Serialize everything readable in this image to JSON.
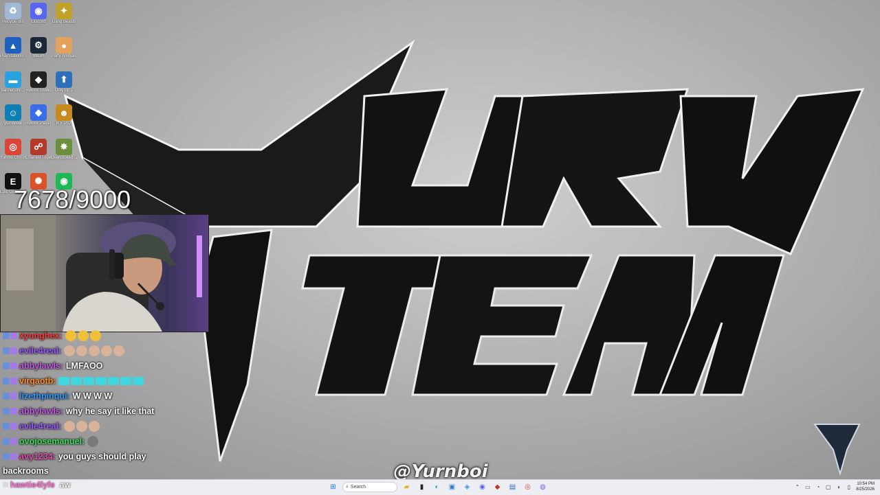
{
  "desktop": {
    "icons": [
      {
        "label": "Recycle Bin",
        "icon": "recycle-bin-icon",
        "color": "#9fb9d6",
        "glyph": "♻"
      },
      {
        "label": "Discord",
        "icon": "discord-icon",
        "color": "#5865f2",
        "glyph": "◉"
      },
      {
        "label": "Gang Beasts",
        "icon": "gang-beasts-icon",
        "color": "#c2a12a",
        "glyph": "✦"
      },
      {
        "label": "PlayStation® Accessories",
        "icon": "playstation-icon",
        "color": "#1f5fbf",
        "glyph": "▲"
      },
      {
        "label": "Steam",
        "icon": "steam-icon",
        "color": "#1b2838",
        "glyph": "⚙"
      },
      {
        "label": "Party Animals",
        "icon": "party-animals-icon",
        "color": "#e3a35a",
        "glyph": "●"
      },
      {
        "label": "bannerjohn...",
        "icon": "file-icon",
        "color": "#29a3e0",
        "glyph": "▬"
      },
      {
        "label": "Roblox Studio",
        "icon": "roblox-studio-icon",
        "color": "#222222",
        "glyph": "◆"
      },
      {
        "label": "Only Up 2",
        "icon": "only-up-icon",
        "color": "#2d6fb8",
        "glyph": "⬆"
      },
      {
        "label": "yurnbowe",
        "icon": "game-icon",
        "color": "#0d7fb5",
        "glyph": "☺"
      },
      {
        "label": "Roblox Player",
        "icon": "roblox-player-icon",
        "color": "#3a6ee8",
        "glyph": "◆"
      },
      {
        "label": "R.E.P.O.",
        "icon": "repo-icon",
        "color": "#c68a1d",
        "glyph": "☻"
      },
      {
        "label": "Yurnbo Chrome",
        "icon": "chrome-icon",
        "color": "#db4437",
        "glyph": "◎"
      },
      {
        "label": "Chained Together",
        "icon": "chained-together-icon",
        "color": "#b33a2a",
        "glyph": "☍"
      },
      {
        "label": "Overcooked! 2",
        "icon": "overcooked-icon",
        "color": "#6b8f3a",
        "glyph": "✸"
      },
      {
        "label": "Epic Games Launcher",
        "icon": "epic-games-icon",
        "color": "#111111",
        "glyph": "E"
      },
      {
        "label": "",
        "icon": "game-icon",
        "color": "#d9522a",
        "glyph": "✺"
      },
      {
        "label": "",
        "icon": "spotify-icon",
        "color": "#1db954",
        "glyph": "◉"
      }
    ]
  },
  "overlay": {
    "goal_counter": "7678/9000",
    "watermark": "@Yurnboi"
  },
  "chat": {
    "messages": [
      {
        "user": "xyunghex",
        "user_color": "#ff3b3b",
        "message": "",
        "emotes": [
          "#f2c037",
          "#f2c037",
          "#f2c037"
        ],
        "emote_style": "round"
      },
      {
        "user": "evile4real",
        "user_color": "#9b59ff",
        "message": "",
        "emotes": [
          "#d9b29a",
          "#d9b29a",
          "#d9b29a",
          "#d9b29a",
          "#d9b29a"
        ],
        "emote_style": "round"
      },
      {
        "user": "abbylawls",
        "user_color": "#c45ce6",
        "message": "LMFAOO",
        "emotes": [],
        "emote_style": "round"
      },
      {
        "user": "virgaotb",
        "user_color": "#ff8c2b",
        "message": "",
        "emotes": [
          "#3fd6e0",
          "#3fd6e0",
          "#3fd6e0",
          "#3fd6e0",
          "#3fd6e0",
          "#3fd6e0",
          "#3fd6e0"
        ],
        "emote_style": "square"
      },
      {
        "user": "lizethpinqui",
        "user_color": "#2f9bff",
        "message": "W W W W",
        "emotes": [],
        "emote_style": "round"
      },
      {
        "user": "abbylawls",
        "user_color": "#c45ce6",
        "message": "why he say it like that",
        "emotes": [],
        "emote_style": "round"
      },
      {
        "user": "evile4real",
        "user_color": "#9b59ff",
        "message": "",
        "emotes": [
          "#d9b29a",
          "#d9b29a",
          "#d9b29a"
        ],
        "emote_style": "round"
      },
      {
        "user": "ovojosemanuel",
        "user_color": "#3ddc5a",
        "message": "",
        "emotes": [
          "#7a7a7a"
        ],
        "emote_style": "round"
      },
      {
        "user": "avy1234",
        "user_color": "#e84ab0",
        "message": "you guys should play",
        "emotes": [],
        "emote_style": "round"
      }
    ],
    "continuation": "backrooms",
    "bottom_user": "hawtie4lyfe",
    "bottom_user_color": "#ff6fd0",
    "bottom_message": "aw"
  },
  "taskbar": {
    "search_placeholder": "Search",
    "time": "10:54 PM",
    "date": "8/25/2026",
    "apps": [
      {
        "name": "start-button",
        "icon": "windows-icon",
        "color": "#1a73e8",
        "glyph": "⊞"
      },
      {
        "name": "file-explorer",
        "icon": "folder-icon",
        "color": "#e8b21a",
        "glyph": "▰"
      },
      {
        "name": "terminal",
        "icon": "terminal-icon",
        "color": "#222222",
        "glyph": "▮"
      },
      {
        "name": "edge",
        "icon": "edge-icon",
        "color": "#1ba1e2",
        "glyph": "◐"
      },
      {
        "name": "store",
        "icon": "store-icon",
        "color": "#3a7bd5",
        "glyph": "▣"
      },
      {
        "name": "photos",
        "icon": "photos-icon",
        "color": "#4a90e2",
        "glyph": "◈"
      },
      {
        "name": "discord",
        "icon": "discord-icon",
        "color": "#5865f2",
        "glyph": "◉"
      },
      {
        "name": "roblox",
        "icon": "roblox-icon",
        "color": "#c0392b",
        "glyph": "◆"
      },
      {
        "name": "app",
        "icon": "app-icon",
        "color": "#2d6fb8",
        "glyph": "▤"
      },
      {
        "name": "chrome",
        "icon": "chrome-icon",
        "color": "#db4437",
        "glyph": "◎"
      },
      {
        "name": "obs",
        "icon": "obs-icon",
        "color": "#7a5af8",
        "glyph": "◍"
      }
    ]
  }
}
